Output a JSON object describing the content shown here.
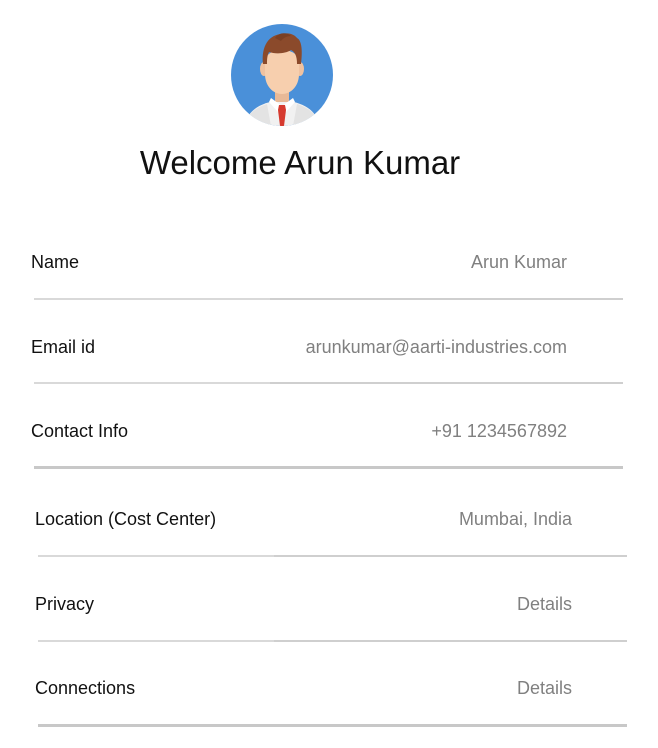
{
  "profile": {
    "avatar_icon": "user-avatar-icon",
    "avatar_bg": "#4a90d9",
    "welcome": "Welcome Arun Kumar"
  },
  "fields": [
    {
      "label": "Name",
      "value": "Arun Kumar"
    },
    {
      "label": "Email id",
      "value": "arunkumar@aarti-industries.com"
    },
    {
      "label": "Contact Info",
      "value": "+91 1234567892"
    },
    {
      "label": "Location (Cost Center)",
      "value": "Mumbai, India"
    },
    {
      "label": "Privacy",
      "value": "Details"
    },
    {
      "label": "Connections",
      "value": "Details"
    }
  ],
  "colors": {
    "label": "#111111",
    "value": "#808080",
    "divider": "#cfcfcf"
  }
}
